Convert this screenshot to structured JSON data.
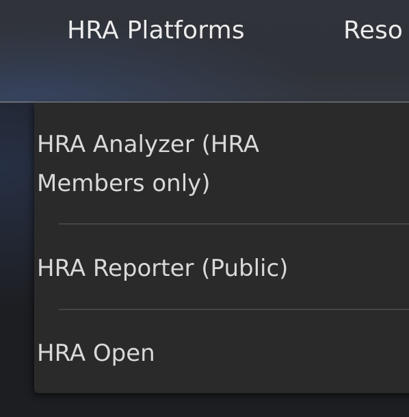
{
  "nav": {
    "items": [
      {
        "label": "HRA Platforms"
      },
      {
        "label": "Reso"
      }
    ]
  },
  "dropdown": {
    "items": [
      {
        "label": "HRA Analyzer (HRA Members only)"
      },
      {
        "label": "HRA Reporter (Public)"
      },
      {
        "label": "HRA Open"
      }
    ]
  }
}
